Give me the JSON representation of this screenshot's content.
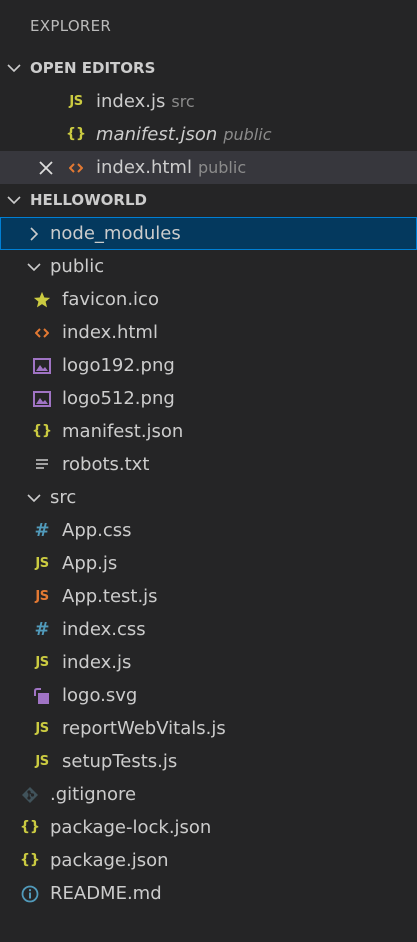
{
  "explorer": {
    "title": "EXPLORER"
  },
  "open_editors": {
    "header": "OPEN EDITORS",
    "items": [
      {
        "name": "index.js",
        "desc": "src",
        "icon": "javascript-icon"
      },
      {
        "name": "manifest.json",
        "desc": "public",
        "icon": "json-icon",
        "italic": true
      },
      {
        "name": "index.html",
        "desc": "public",
        "icon": "html-icon",
        "active": true
      }
    ]
  },
  "workspace": {
    "header": "HELLOWORLD",
    "items": [
      {
        "name": "node_modules",
        "type": "folder-collapsed",
        "selected": true
      },
      {
        "name": "public",
        "type": "folder-open"
      },
      {
        "name": "favicon.ico",
        "icon": "favicon-star-icon"
      },
      {
        "name": "index.html",
        "icon": "html-icon"
      },
      {
        "name": "logo192.png",
        "icon": "image-icon"
      },
      {
        "name": "logo512.png",
        "icon": "image-icon"
      },
      {
        "name": "manifest.json",
        "icon": "json-icon"
      },
      {
        "name": "robots.txt",
        "icon": "text-file-icon"
      },
      {
        "name": "src",
        "type": "folder-open"
      },
      {
        "name": "App.css",
        "icon": "css-icon"
      },
      {
        "name": "App.js",
        "icon": "javascript-icon"
      },
      {
        "name": "App.test.js",
        "icon": "test-js-icon"
      },
      {
        "name": "index.css",
        "icon": "css-icon"
      },
      {
        "name": "index.js",
        "icon": "javascript-icon"
      },
      {
        "name": "logo.svg",
        "icon": "svg-icon"
      },
      {
        "name": "reportWebVitals.js",
        "icon": "javascript-icon"
      },
      {
        "name": "setupTests.js",
        "icon": "javascript-icon"
      },
      {
        "name": ".gitignore",
        "icon": "git-icon"
      },
      {
        "name": "package-lock.json",
        "icon": "json-icon"
      },
      {
        "name": "package.json",
        "icon": "json-icon"
      },
      {
        "name": "README.md",
        "icon": "info-icon"
      }
    ]
  },
  "colors": {
    "background": "#252526",
    "selected_bg": "#04395e",
    "selected_border": "#007fd4",
    "active_bg": "#37373d",
    "js_yellow": "#cbcb41",
    "html_orange": "#e37933",
    "css_blue": "#519aba",
    "image_purple": "#a074c4"
  }
}
